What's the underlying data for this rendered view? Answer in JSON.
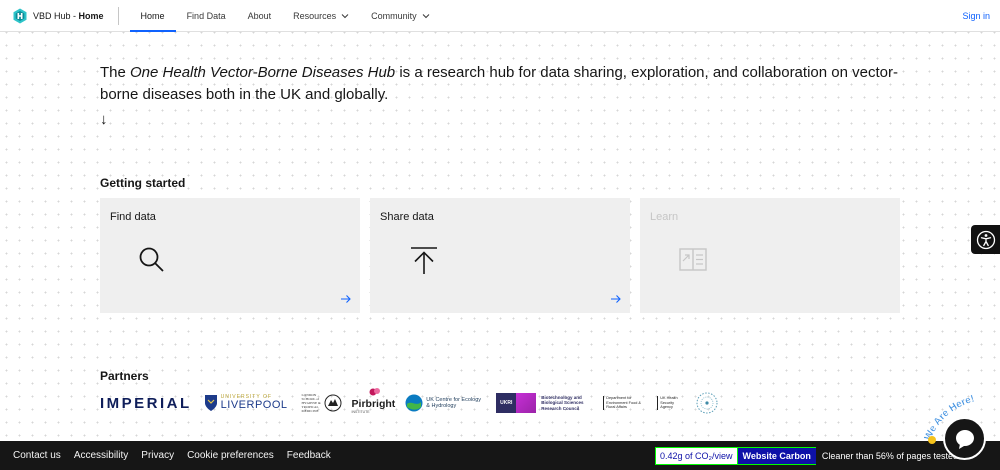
{
  "header": {
    "brand_name": "VBD Hub",
    "brand_separator": " - ",
    "brand_page": "Home",
    "nav": [
      {
        "label": "Home",
        "active": true
      },
      {
        "label": "Find Data"
      },
      {
        "label": "About"
      },
      {
        "label": "Resources",
        "has_dropdown": true
      },
      {
        "label": "Community",
        "has_dropdown": true
      }
    ],
    "sign_in": "Sign in"
  },
  "intro": {
    "prefix": "The ",
    "hub_name": "One Health Vector-Borne Diseases Hub",
    "suffix": " is a research hub for data sharing, exploration, and collaboration on vector-borne diseases both in the UK and globally.",
    "scroll_arrow": "↓"
  },
  "getting_started": {
    "title": "Getting started",
    "tiles": [
      {
        "label": "Find data",
        "icon": "search-icon",
        "enabled": true
      },
      {
        "label": "Share data",
        "icon": "upload-icon",
        "enabled": true
      },
      {
        "label": "Learn",
        "icon": "document-icon",
        "enabled": false
      }
    ]
  },
  "partners": {
    "title": "Partners",
    "logos": {
      "imperial": "IMPERIAL",
      "liverpool_top": "UNIVERSITY OF",
      "liverpool_name": "LIVERPOOL",
      "lshtm": "LONDON SCHOOL of HYGIENE & TROPICAL MEDICINE",
      "pirbright": "Pirbright",
      "pirbright_sub": "INSTITUTE",
      "ukceh": "UK Centre for Ecology & Hydrology",
      "ukri": "UKRI",
      "bbsrc": "Biotechnology and Biological Sciences Research Council",
      "defra": "Department for Environment Food & Rural Affairs",
      "ukhsa": "UK Health Security Agency"
    }
  },
  "footer": {
    "links": [
      "Contact us",
      "Accessibility",
      "Privacy",
      "Cookie preferences",
      "Feedback"
    ],
    "carbon_value": "0.42g of CO₂/view",
    "carbon_brand": "Website Carbon",
    "carbon_cleaner": "Cleaner than 56% of pages tested"
  },
  "chat": {
    "tag": "We Are Here!"
  },
  "colors": {
    "accent": "#0f62fe",
    "tile_bg": "#efefef",
    "footer_bg": "#161616",
    "carbon_blue": "#0e11a8",
    "carbon_green": "#00ff00"
  }
}
